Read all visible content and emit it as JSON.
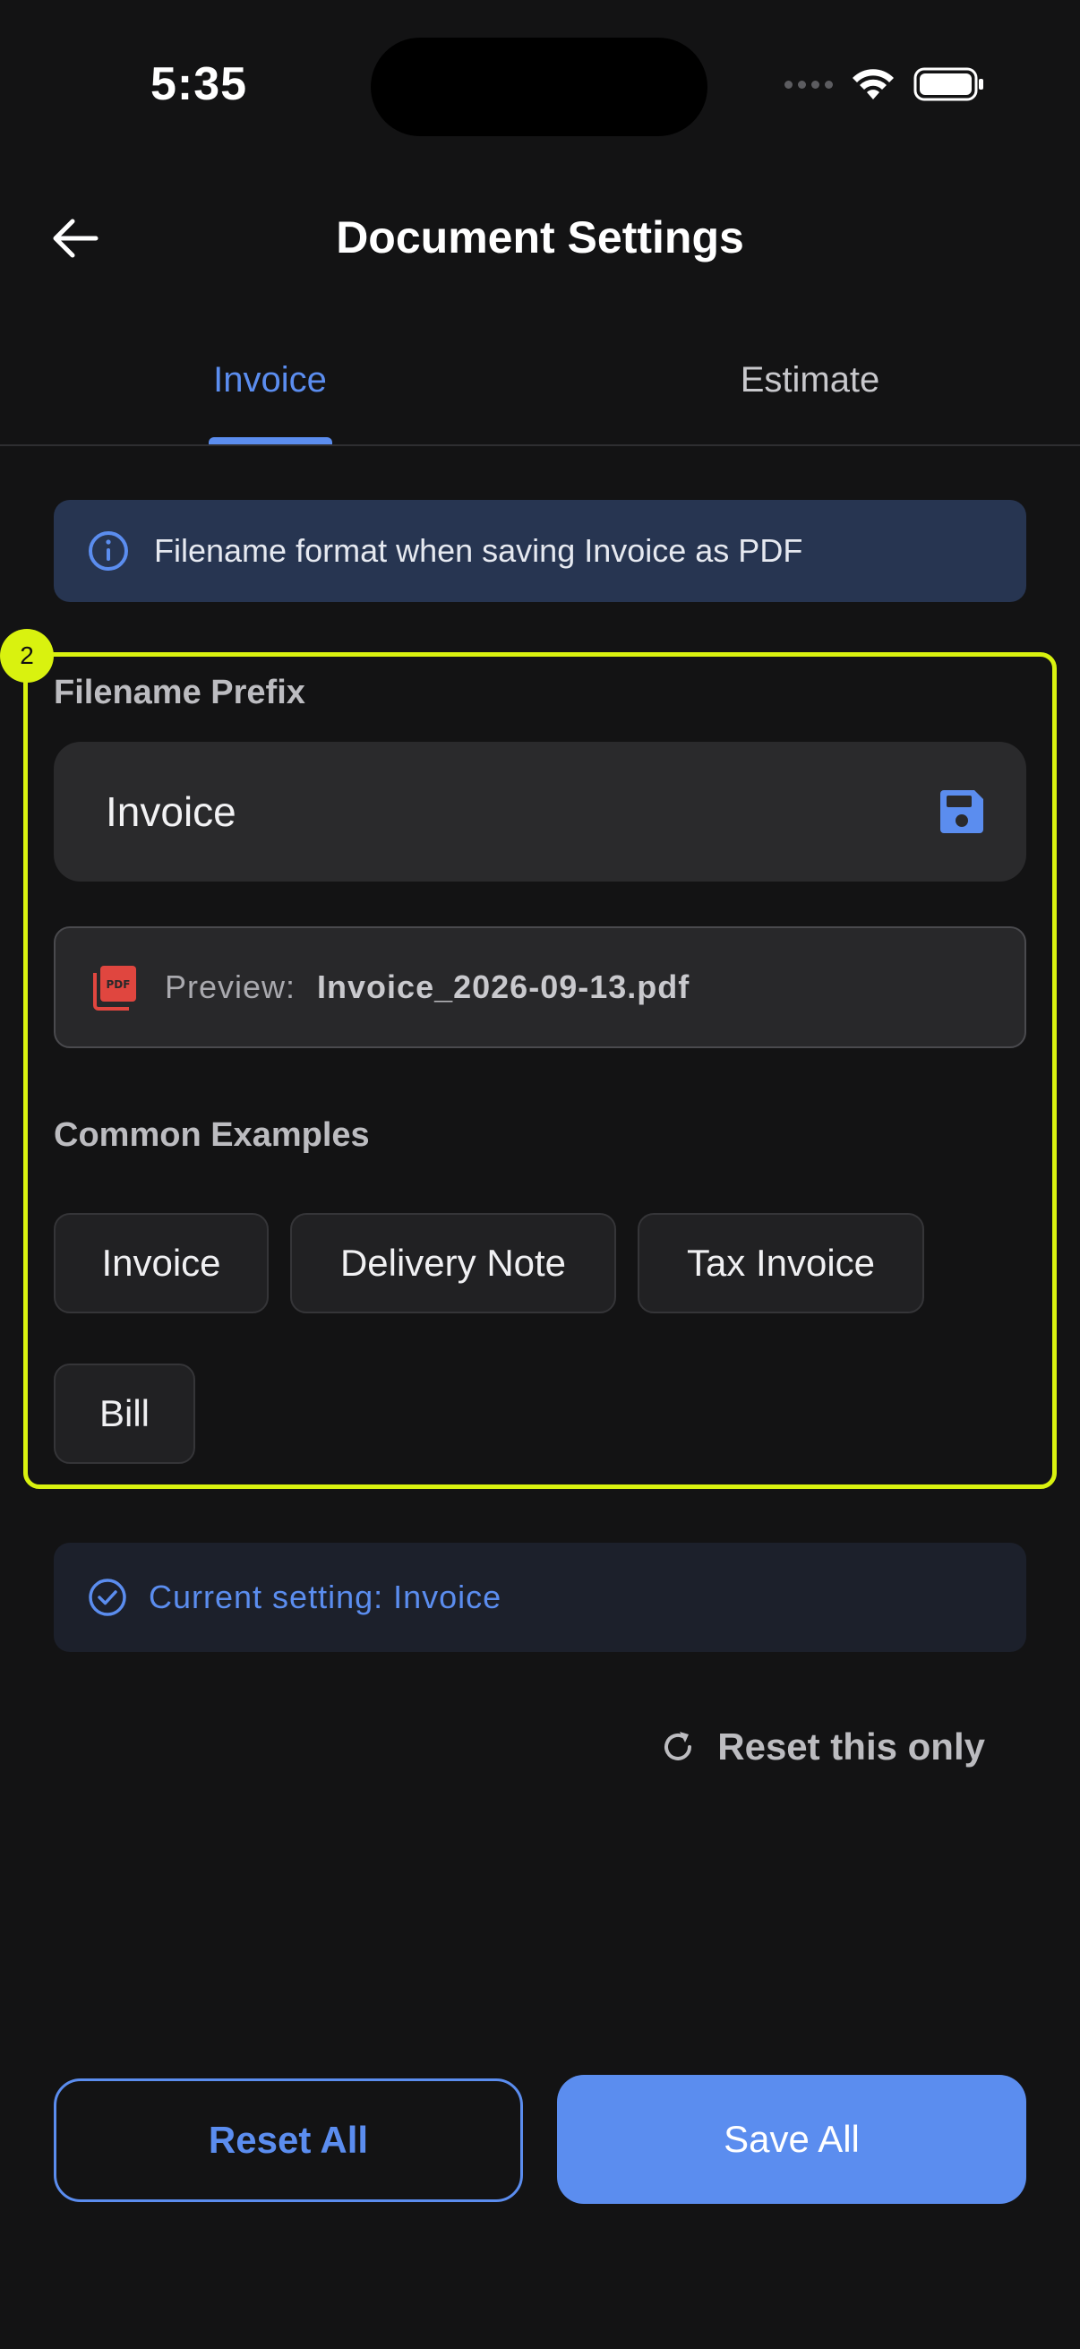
{
  "status_bar": {
    "time": "5:35"
  },
  "header": {
    "title": "Document Settings"
  },
  "tabs": [
    {
      "label": "Invoice",
      "active": true
    },
    {
      "label": "Estimate",
      "active": false
    }
  ],
  "info_banner": {
    "text": "Filename format when saving Invoice as PDF"
  },
  "highlight_badge": "2",
  "filename_prefix": {
    "label": "Filename Prefix",
    "value": "Invoice",
    "placeholder": ""
  },
  "preview": {
    "label": "Preview:",
    "filename": "Invoice_2026-09-13.pdf"
  },
  "examples": {
    "title": "Common Examples",
    "chips": [
      "Invoice",
      "Delivery Note",
      "Tax Invoice",
      "Bill"
    ]
  },
  "current_setting": {
    "text": "Current setting: Invoice"
  },
  "reset_only": {
    "label": "Reset this only"
  },
  "buttons": {
    "reset_all": "Reset All",
    "save_all": "Save All"
  },
  "colors": {
    "accent": "#5b8def",
    "highlight": "#d9f20f",
    "background": "#131314",
    "pdf_icon": "#e0463f"
  },
  "icons": [
    "back-arrow-icon",
    "wifi-icon",
    "battery-icon",
    "info-icon",
    "save-icon",
    "pdf-icon",
    "check-circle-icon",
    "refresh-icon"
  ]
}
